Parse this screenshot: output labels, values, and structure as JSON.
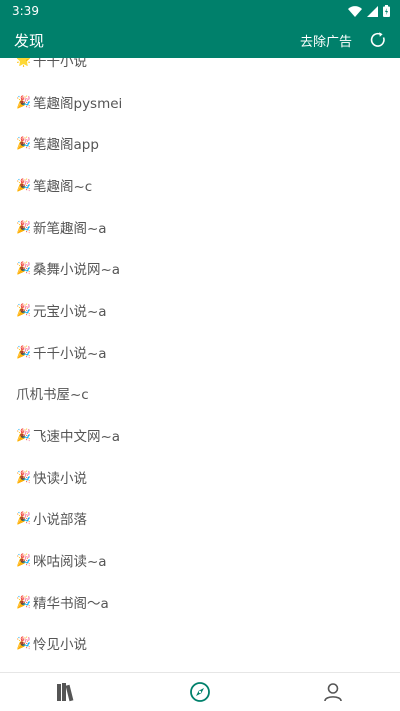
{
  "status_bar": {
    "time": "3:39"
  },
  "header": {
    "title": "发现",
    "remove_ads": "去除广告"
  },
  "list": [
    {
      "icon": "star-icon",
      "glyph": "🌟",
      "label": "千千小说"
    },
    {
      "icon": "party-popper-icon",
      "glyph": "🎉",
      "label": "笔趣阁pysmei"
    },
    {
      "icon": "party-popper-icon",
      "glyph": "🎉",
      "label": "笔趣阁app"
    },
    {
      "icon": "party-popper-icon",
      "glyph": "🎉",
      "label": "笔趣阁~c"
    },
    {
      "icon": "party-popper-icon",
      "glyph": "🎉",
      "label": "新笔趣阁~a"
    },
    {
      "icon": "party-popper-icon",
      "glyph": "🎉",
      "label": "桑舞小说网~a"
    },
    {
      "icon": "party-popper-icon",
      "glyph": "🎉",
      "label": "元宝小说~a"
    },
    {
      "icon": "party-popper-icon",
      "glyph": "🎉",
      "label": "千千小说~a"
    },
    {
      "icon": "",
      "glyph": "",
      "label": "爪机书屋~c"
    },
    {
      "icon": "party-popper-icon",
      "glyph": "🎉",
      "label": "飞速中文网~a"
    },
    {
      "icon": "party-popper-icon",
      "glyph": "🎉",
      "label": "快读小说"
    },
    {
      "icon": "party-popper-icon",
      "glyph": "🎉",
      "label": "小说部落"
    },
    {
      "icon": "party-popper-icon",
      "glyph": "🎉",
      "label": "咪咕阅读~a"
    },
    {
      "icon": "party-popper-icon",
      "glyph": "🎉",
      "label": "精华书阁〜a"
    },
    {
      "icon": "party-popper-icon",
      "glyph": "🎉",
      "label": "怜见小说"
    }
  ],
  "bottom_nav": [
    {
      "icon": "bookshelf-icon",
      "active": false
    },
    {
      "icon": "compass-icon",
      "active": true
    },
    {
      "icon": "profile-icon",
      "active": false
    }
  ],
  "colors": {
    "primary": "#00806b",
    "text": "#555555",
    "nav_inactive": "#555555"
  }
}
